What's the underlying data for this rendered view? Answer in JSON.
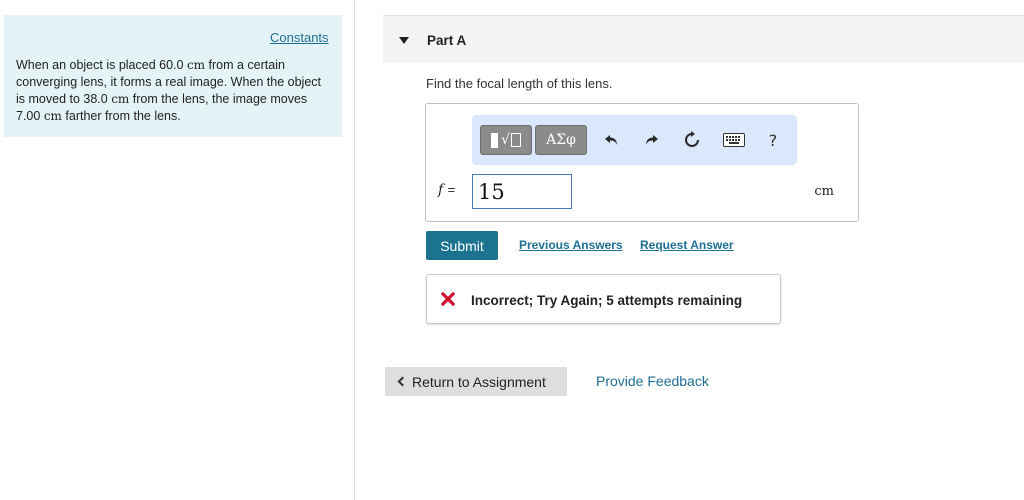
{
  "sidebar": {
    "constants_label": "Constants",
    "problem": {
      "p1": "When an object is placed 60.0 ",
      "u1": "cm",
      "p2": " from a certain converging lens, it forms a real image. When the object is moved to 38.0 ",
      "u2": "cm",
      "p3": " from the lens, the image moves 7.00 ",
      "u3": "cm",
      "p4": " farther from the lens."
    }
  },
  "part": {
    "title": "Part A",
    "question": "Find the focal length of this lens."
  },
  "toolbar": {
    "greek_label": "ΑΣφ",
    "help_label": "?",
    "icons": [
      "templates-icon",
      "greek-symbols-icon",
      "undo-icon",
      "redo-icon",
      "reset-icon",
      "keyboard-icon",
      "help-icon"
    ]
  },
  "answer": {
    "variable": "f",
    "equals": "=",
    "value": "15",
    "unit": "cm"
  },
  "actions": {
    "submit_label": "Submit",
    "previous_answers_label": "Previous Answers",
    "request_answer_label": "Request Answer"
  },
  "feedback": {
    "message": "Incorrect; Try Again; 5 attempts remaining",
    "color": "#d0112b"
  },
  "footer": {
    "return_label": "Return to Assignment",
    "provide_feedback_label": "Provide Feedback"
  },
  "colors": {
    "accent": "#1c7390",
    "link": "#1d6f94",
    "sidebar_bg": "#e4f3f5",
    "toolbar_bg": "#dbe7fb"
  }
}
